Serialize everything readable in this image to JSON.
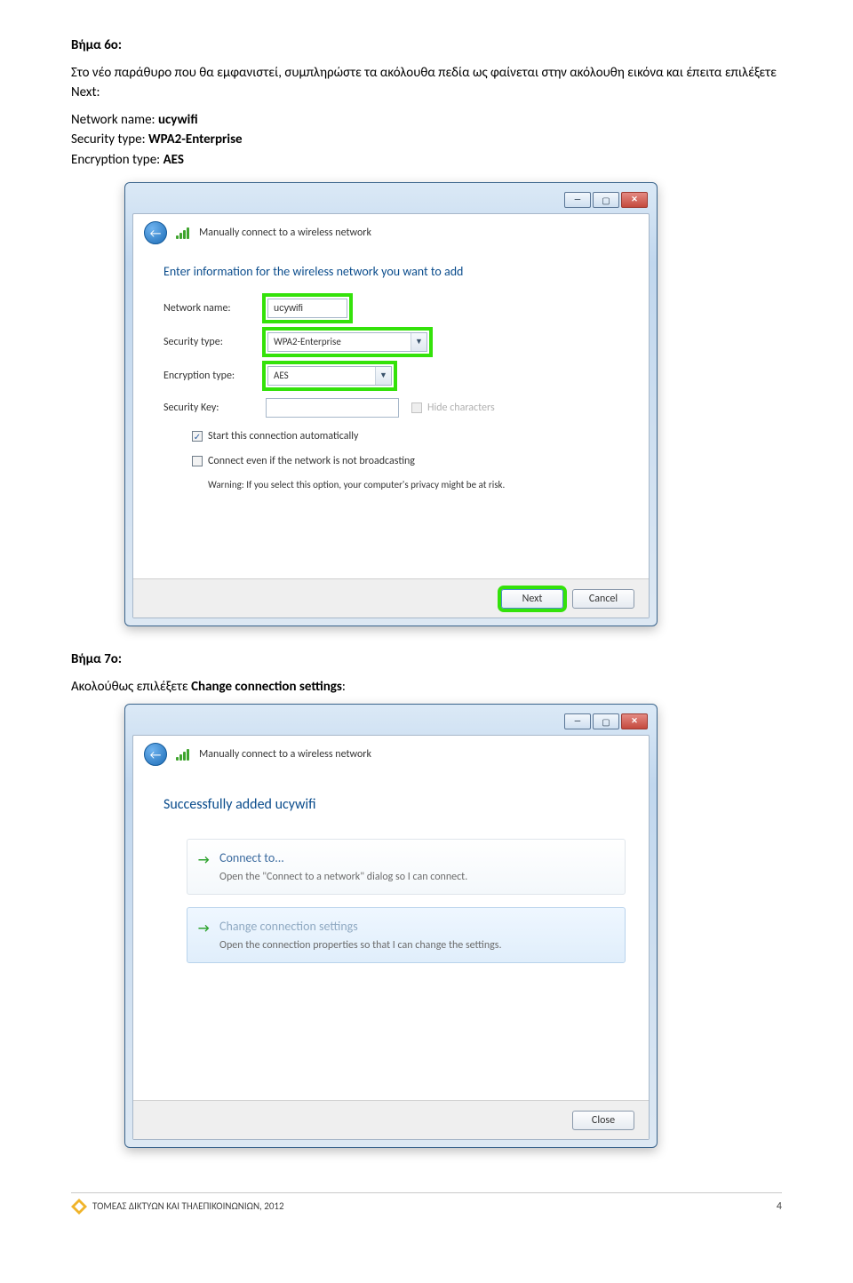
{
  "step6": {
    "title": "Βήμα 6ο:",
    "intro": "Στο νέο παράθυρο που θα εμφανιστεί, συμπληρώστε τα ακόλουθα πεδία ως φαίνεται στην ακόλουθη εικόνα και έπειτα επιλέξετε Next:",
    "lines": {
      "network_label": "Network name: ",
      "network_value": "ucywifi",
      "security_label": "Security type: ",
      "security_value": "WPA2-Enterprise",
      "encryption_label": "Encryption type: ",
      "encryption_value": "AES"
    }
  },
  "step7": {
    "title": "Βήμα 7ο:",
    "intro": "Ακολούθως επιλέξετε Change connection settings:"
  },
  "dialog": {
    "breadcrumb": "Manually connect to a wireless network",
    "prompt": "Enter information for the wireless network you want to add",
    "labels": {
      "network_name": "Network name:",
      "security_type": "Security type:",
      "encryption_type": "Encryption type:",
      "security_key": "Security Key:"
    },
    "values": {
      "network_name": "ucywifi",
      "security_type": "WPA2-Enterprise",
      "encryption_type": "AES",
      "security_key": ""
    },
    "hide_characters": "Hide characters",
    "cb_auto": "Start this connection automatically",
    "cb_broadcast": "Connect even if the network is not broadcasting",
    "cb_warning": "Warning: If you select this option, your computer's privacy might be at risk.",
    "next": "Next",
    "cancel": "Cancel"
  },
  "dialog2": {
    "success": "Successfully added ucywifi",
    "card1": {
      "title": "Connect to...",
      "sub": "Open the \"Connect to a network\" dialog so I can connect."
    },
    "card2": {
      "title": "Change connection settings",
      "sub": "Open the connection properties so that I can change the settings."
    },
    "close": "Close"
  },
  "footer": {
    "text": "ΤΟΜΕΑΣ ΔΙΚΤΥΩΝ ΚΑΙ ΤΗΛΕΠΙΚΟΙΝΩΝΙΩΝ, 2012",
    "page": "4"
  }
}
